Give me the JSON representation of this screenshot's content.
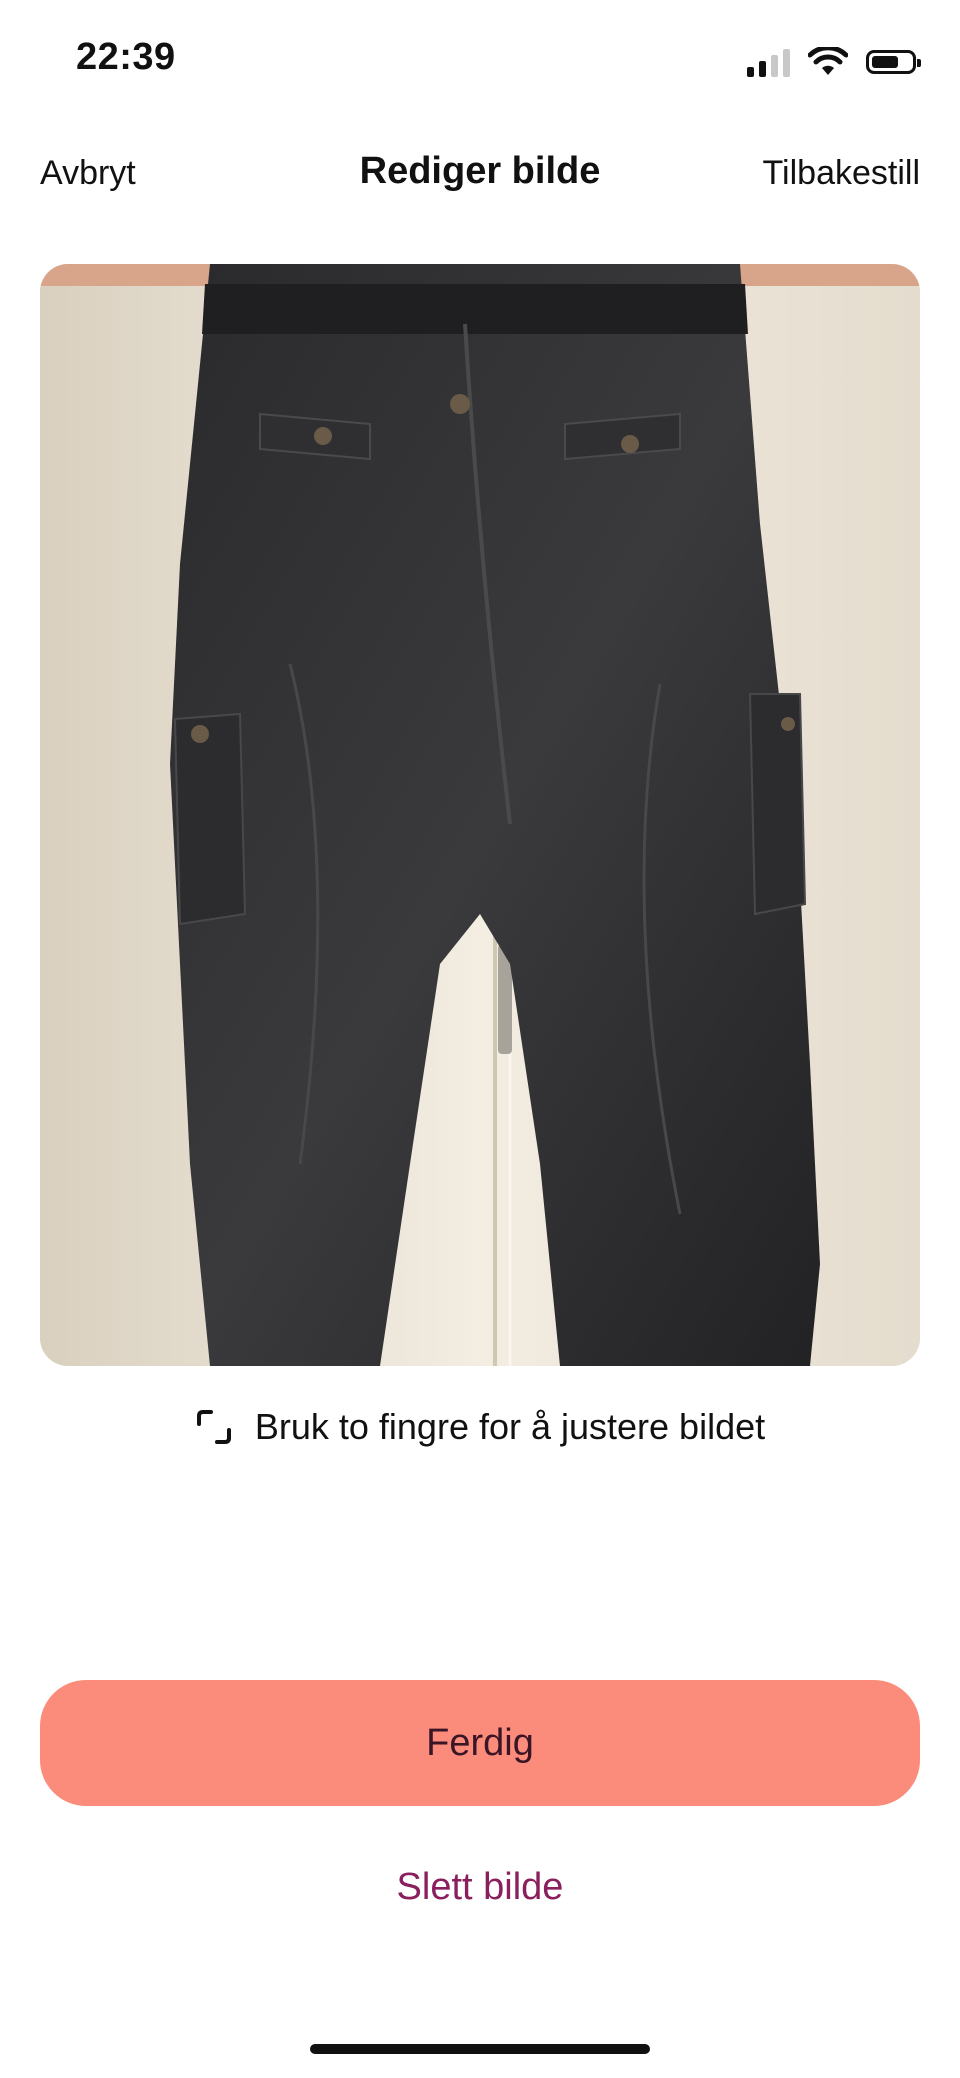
{
  "status_bar": {
    "time": "22:39",
    "icons": [
      "signal-icon",
      "wifi-icon",
      "battery-icon"
    ]
  },
  "nav": {
    "cancel_label": "Avbryt",
    "title": "Rediger bilde",
    "reset_label": "Tilbakestill"
  },
  "photo": {
    "subject": "photo-black-cargo-pants"
  },
  "hint": {
    "icon": "crop-icon",
    "text": "Bruk to fingre for å justere bildet"
  },
  "actions": {
    "done_label": "Ferdig",
    "delete_label": "Slett bilde"
  },
  "colors": {
    "primary_button": "#fb8c7c",
    "primary_button_text": "#3a1526",
    "delete_link": "#8a1f5e",
    "text": "#111111",
    "background": "#ffffff"
  }
}
